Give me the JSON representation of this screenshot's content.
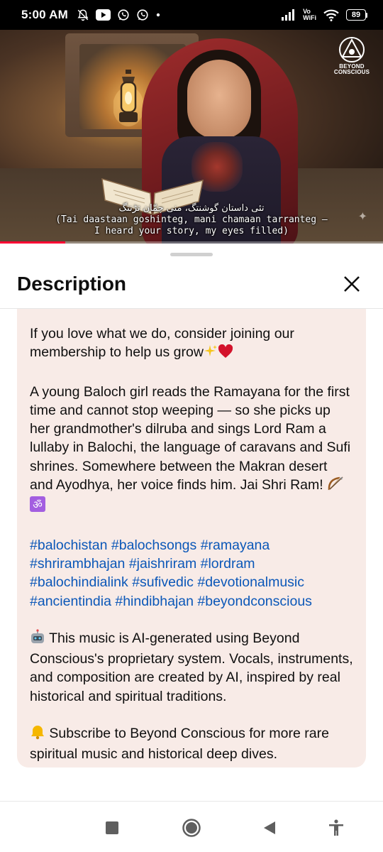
{
  "status_bar": {
    "time": "5:00 AM",
    "network_top": "Vo",
    "network_bottom": "WiFi",
    "battery": "89",
    "icons": [
      "mute-bell-icon",
      "youtube-icon",
      "whatsapp-icon",
      "whatsapp-icon",
      "dot-icon",
      "signal-icon",
      "wifi-icon",
      "battery-icon"
    ]
  },
  "video": {
    "channel_logo_line1": "BEYOND",
    "channel_logo_line2": "CONSCIOUS",
    "subtitle_urdu": "تئی داستان گوشنتگ، منی چمّان تڑنتگ",
    "subtitle_line1": "(Tai daastaan goshinteg, mani chamaan tarranteg —",
    "subtitle_line2": "I heard your story, my eyes filled)",
    "progress_fraction": 0.17,
    "progress_color": "#ff0033"
  },
  "sheet": {
    "title": "Description",
    "close_icon": "close-icon"
  },
  "description": {
    "para1": "If you love what we do, consider joining our membership to help us grow",
    "para1_emojis": [
      "sparkles",
      "red-heart"
    ],
    "para2": "A young Baloch girl reads the Ramayana for the first time and cannot stop weeping — so she picks up her grandmother's dilruba and sings Lord Ram a lullaby in Balochi, the language of caravans and Sufi shrines. Somewhere between the Makran desert and Ayodhya, her voice finds him. Jai Shri Ram!",
    "para2_emojis": [
      "bow-and-arrow",
      "om"
    ],
    "hashtags": [
      "#balochistan",
      "#balochsongs",
      "#ramayana",
      "#shrirambhajan",
      "#jaishriram",
      "#lordram",
      "#balochindialink",
      "#sufivedic",
      "#devotionalmusic",
      "#ancientindia",
      "#hindibhajan",
      "#beyondconscious"
    ],
    "hashtag_color": "#0b57b8",
    "para3": "This music is AI-generated using Beyond Conscious's proprietary system. Vocals, instruments, and composition are created by AI, inspired by real historical and spiritual traditions.",
    "para3_emoji": "robot",
    "para4": "Subscribe to Beyond Conscious for more rare spiritual music and historical deep dives.",
    "para4_emoji": "bell"
  },
  "nav_bar": {
    "buttons": [
      "recents-square-icon",
      "home-circle-icon",
      "back-triangle-icon",
      "accessibility-icon"
    ]
  }
}
